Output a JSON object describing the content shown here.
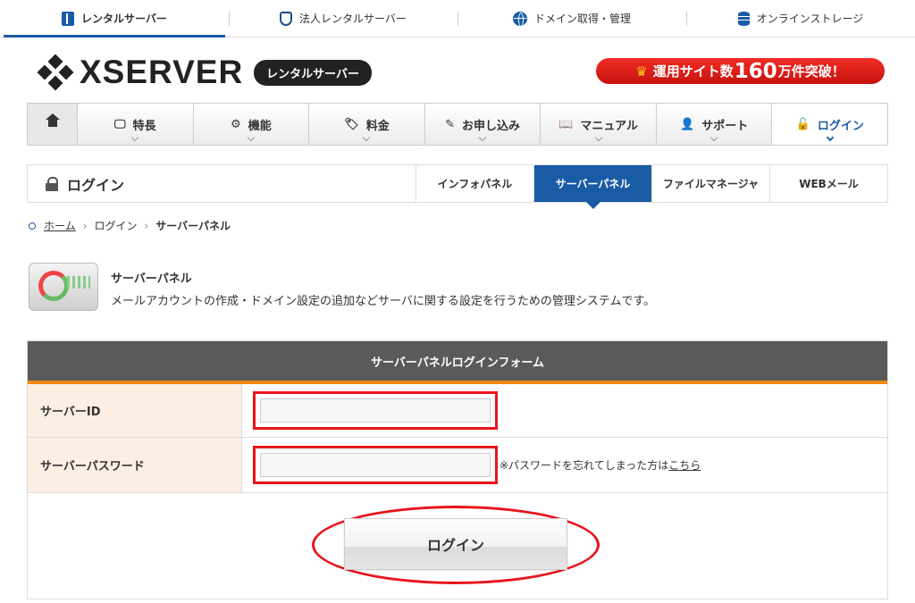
{
  "topbar": {
    "items": [
      {
        "label": "レンタルサーバー",
        "icon": "rental-book-icon",
        "active": true
      },
      {
        "label": "法人レンタルサーバー",
        "icon": "shield-icon"
      },
      {
        "label": "ドメイン取得・管理",
        "icon": "globe-icon"
      },
      {
        "label": "オンラインストレージ",
        "icon": "database-icon"
      }
    ]
  },
  "logo": {
    "word": "XSERVER",
    "tag": "レンタルサーバー"
  },
  "banner": {
    "prefix": "運用サイト数",
    "number": "160",
    "suffix": "万件突破！",
    "icon": "crown-icon"
  },
  "nav": {
    "items": [
      {
        "label": "特長",
        "icon": "monitor-icon"
      },
      {
        "label": "機能",
        "icon": "gears-icon"
      },
      {
        "label": "料金",
        "icon": "tag-icon"
      },
      {
        "label": "お申し込み",
        "icon": "pen-icon"
      },
      {
        "label": "マニュアル",
        "icon": "book-icon"
      },
      {
        "label": "サポート",
        "icon": "person-icon"
      },
      {
        "label": "ログイン",
        "icon": "lock-icon",
        "active": true
      }
    ]
  },
  "subnav": {
    "title": "ログイン",
    "tabs": [
      "インフォパネル",
      "サーバーパネル",
      "ファイルマネージャ",
      "WEBメール"
    ],
    "active_tab": "サーバーパネル"
  },
  "breadcrumb": {
    "home": "ホーム",
    "sep": "›",
    "login": "ログイン",
    "current": "サーバーパネル"
  },
  "intro": {
    "title": "サーバーパネル",
    "description": "メールアカウントの作成・ドメイン設定の追加などサーバに関する設定を行うための管理システムです。"
  },
  "form": {
    "header": "サーバーパネルログインフォーム",
    "server_id_label": "サーバーID",
    "server_id_value": "",
    "password_label": "サーバーパスワード",
    "password_value": "",
    "forgot_text": "※パスワードを忘れてしまった方は",
    "forgot_link": "こちら",
    "login_button": "ログイン"
  },
  "colors": {
    "brand_blue": "#1a5ba5",
    "accent_orange": "#f08a10",
    "highlight_red": "#e8141c",
    "label_bg": "#fbeee3"
  }
}
